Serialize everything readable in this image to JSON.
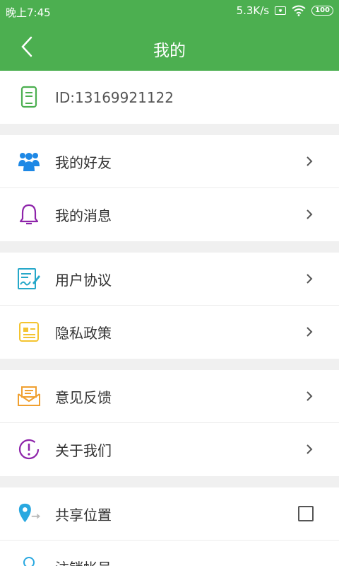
{
  "status_bar": {
    "time": "晚上7:45",
    "speed": "5.3K/s",
    "battery": "100"
  },
  "header": {
    "title": "我的"
  },
  "account": {
    "id_label": "ID:13169921122"
  },
  "menu": {
    "friends": "我的好友",
    "messages": "我的消息",
    "user_agreement": "用户协议",
    "privacy_policy": "隐私政策",
    "feedback": "意见反馈",
    "about_us": "关于我们",
    "share_location": "共享位置",
    "cancel_account": "注销帐号"
  },
  "colors": {
    "brand": "#4caf50",
    "friends_icon": "#1e88e5",
    "messages_icon": "#8e24aa",
    "agreement_icon": "#26a8c9",
    "privacy_icon": "#f4c430",
    "feedback_icon": "#f0a030",
    "about_icon": "#8e24aa",
    "location_icon": "#29a8e0"
  }
}
